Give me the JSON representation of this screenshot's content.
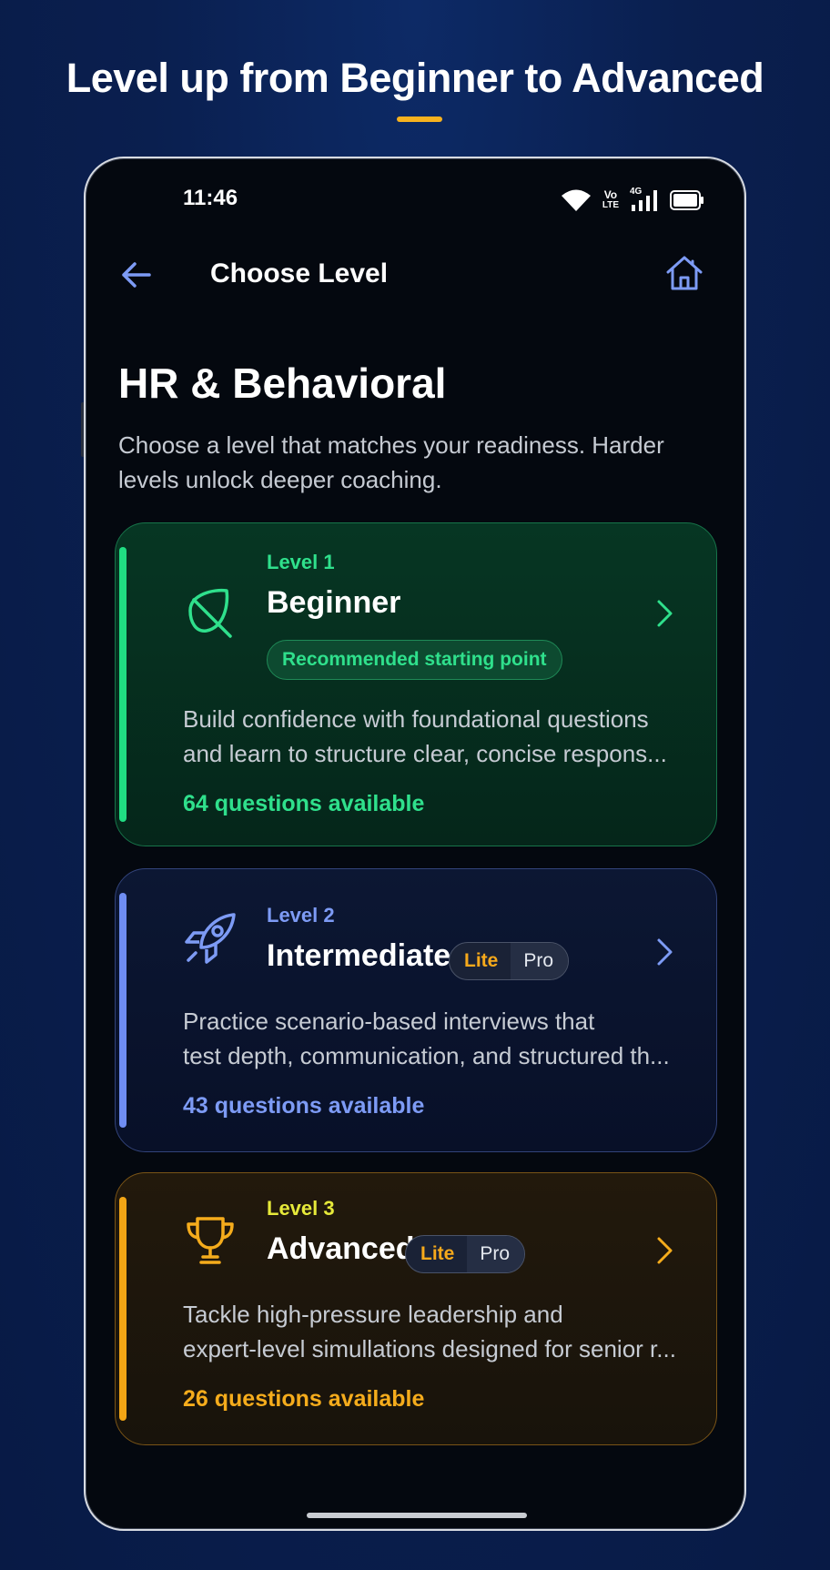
{
  "headline": "Level up from Beginner to Advanced",
  "colors": {
    "headline_underline": "#f7b21e",
    "beginner_accent": "#20dd82",
    "intermediate_accent": "#6f8df2",
    "advanced_accent": "#f2a515"
  },
  "status_bar": {
    "time": "11:46",
    "icons": [
      "wifi-icon",
      "volte-icon",
      "signal-4g-icon",
      "battery-icon"
    ],
    "volte_top": "Vo",
    "volte_bottom": "LTE",
    "network": "4G"
  },
  "nav": {
    "back_icon": "arrow-left-icon",
    "title": "Choose Level",
    "home_icon": "home-icon"
  },
  "page": {
    "title": "HR & Behavioral",
    "subtitle": "Choose a level that matches your readiness. Harder levels unlock deeper coaching."
  },
  "levels": [
    {
      "level": "Level 1",
      "name": "Beginner",
      "icon": "leaf-icon",
      "badge": "Recommended starting point",
      "desc_line1": "Build confidence with foundational questions",
      "desc_line2": "and learn to structure clear, concise respons...",
      "count": "64 questions available"
    },
    {
      "level": "Level 2",
      "name": "Intermediate",
      "icon": "rocket-icon",
      "tier_lite": "Lite",
      "tier_pro": "Pro",
      "desc_line1": "Practice scenario-based interviews that",
      "desc_line2": "test depth, communication, and structured th...",
      "count": "43 questions available"
    },
    {
      "level": "Level 3",
      "name": "Advanced",
      "icon": "trophy-icon",
      "tier_lite": "Lite",
      "tier_pro": "Pro",
      "desc_line1": "Tackle high-pressure leadership and",
      "desc_line2": "expert-level simullations designed for senior r...",
      "count": "26 questions available"
    }
  ]
}
